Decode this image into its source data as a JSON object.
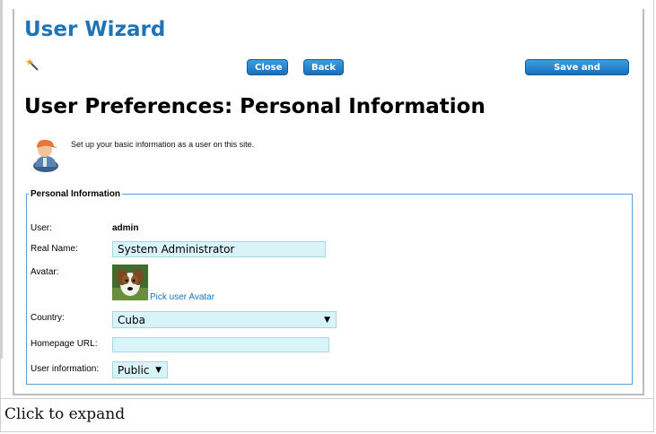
{
  "wizard": {
    "title": "User Wizard"
  },
  "buttons": {
    "close": "Close",
    "back": "Back",
    "save_continue": "Save and Continue"
  },
  "page": {
    "heading": "User Preferences: Personal Information",
    "intro": "Set up your basic information as a user on this site."
  },
  "form": {
    "legend": "Personal Information",
    "user": {
      "label": "User:",
      "value": "admin"
    },
    "real_name": {
      "label": "Real Name:",
      "value": "System Administrator"
    },
    "avatar": {
      "label": "Avatar:",
      "link": "Pick user Avatar"
    },
    "country": {
      "label": "Country:",
      "selected": "Cuba"
    },
    "homepage": {
      "label": "Homepage URL:",
      "value": ""
    },
    "user_information": {
      "label": "User information:",
      "selected": "Public"
    }
  },
  "caption": "Click to expand",
  "icons": {
    "wand": "magic-wand-icon",
    "user": "user-profile-icon",
    "dropdown": "dropdown-arrow-icon"
  },
  "colors": {
    "brand_blue": "#1f73b7",
    "button_blue": "#2a86cf",
    "field_bg": "#d9f4f9",
    "fieldset_border": "#5b9bd5"
  }
}
